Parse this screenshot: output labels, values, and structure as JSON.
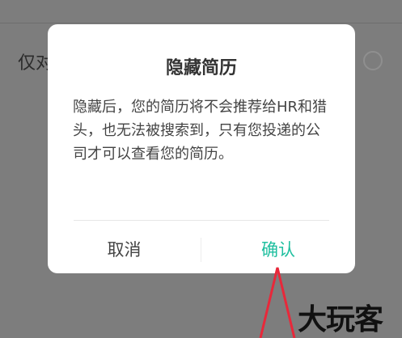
{
  "background": {
    "row_label": "仅对",
    "row_selected": false
  },
  "dialog": {
    "title": "隐藏简历",
    "message": "隐藏后，您的简历将不会推荐给HR和猎头，也无法被搜索到，只有您投递的公司才可以查看您的简历。",
    "cancel_label": "取消",
    "confirm_label": "确认",
    "confirm_color": "#1fbf9f"
  },
  "annotation": {
    "arrow_color": "#e8283a"
  },
  "watermark": {
    "text": "大玩客"
  }
}
